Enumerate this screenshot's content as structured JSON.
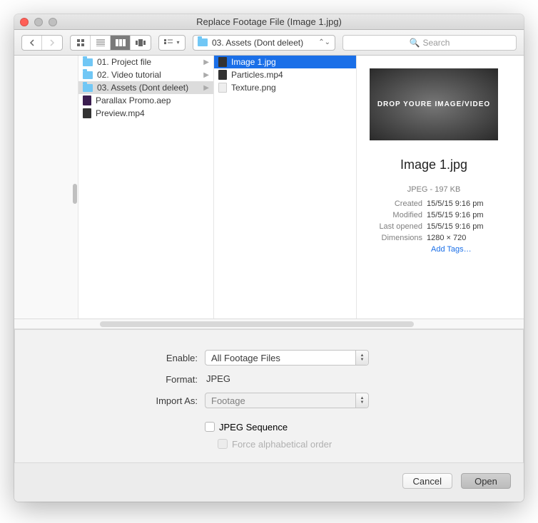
{
  "title": "Replace Footage File (Image 1.jpg)",
  "toolbar": {
    "path_label": "03. Assets (Dont deleet)",
    "search_placeholder": "Search"
  },
  "col1": [
    {
      "icon": "folder",
      "label": "01. Project file",
      "arrow": true
    },
    {
      "icon": "folder",
      "label": "02. Video tutorial",
      "arrow": true
    },
    {
      "icon": "folder",
      "label": "03. Assets (Dont deleet)",
      "arrow": true,
      "selected": true
    },
    {
      "icon": "aep",
      "label": "Parallax Promo.aep"
    },
    {
      "icon": "mov",
      "label": "Preview.mp4"
    }
  ],
  "col2": [
    {
      "icon": "jpg",
      "label": "Image 1.jpg",
      "selected": true
    },
    {
      "icon": "mov",
      "label": "Particles.mp4"
    },
    {
      "icon": "png",
      "label": "Texture.png"
    }
  ],
  "preview": {
    "placeholder_text": "DROP YOURE IMAGE/VIDEO",
    "filename": "Image 1.jpg",
    "filetype": "JPEG - 197 KB",
    "meta": [
      {
        "label": "Created",
        "value": "15/5/15 9:16 pm"
      },
      {
        "label": "Modified",
        "value": "15/5/15 9:16 pm"
      },
      {
        "label": "Last opened",
        "value": "15/5/15 9:16 pm"
      },
      {
        "label": "Dimensions",
        "value": "1280 × 720"
      }
    ],
    "add_tags": "Add Tags…"
  },
  "options": {
    "enable_label": "Enable:",
    "enable_value": "All Footage Files",
    "format_label": "Format:",
    "format_value": "JPEG",
    "importas_label": "Import As:",
    "importas_value": "Footage",
    "sequence_label": "JPEG Sequence",
    "alpha_label": "Force alphabetical order"
  },
  "footer": {
    "cancel": "Cancel",
    "open": "Open"
  }
}
